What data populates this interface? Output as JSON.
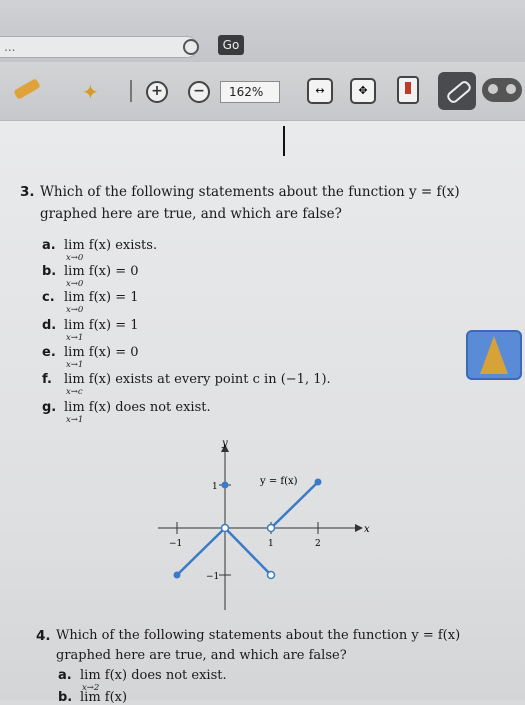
{
  "browser": {
    "url_text": "...",
    "go_label": "Go"
  },
  "toolbar": {
    "zoom": "162%",
    "pan_label": "↔",
    "fit_label": "✥"
  },
  "problem3": {
    "number": "3.",
    "stem_line1": "Which of the following statements about the function y = f(x)",
    "stem_line2": "graphed here are true, and which are false?",
    "items": [
      {
        "label": "a.",
        "text": "lim f(x) exists.",
        "sub": "x→0"
      },
      {
        "label": "b.",
        "text": "lim f(x) = 0",
        "sub": "x→0"
      },
      {
        "label": "c.",
        "text": "lim f(x) = 1",
        "sub": "x→0"
      },
      {
        "label": "d.",
        "text": "lim f(x) = 1",
        "sub": "x→1"
      },
      {
        "label": "e.",
        "text": "lim f(x) = 0",
        "sub": "x→1"
      },
      {
        "label": "f.",
        "text": "lim f(x) exists at every point c in (−1, 1).",
        "sub": "x→c"
      },
      {
        "label": "g.",
        "text": "lim f(x) does not exist.",
        "sub": "x→1"
      }
    ]
  },
  "graph": {
    "y_axis_label": "y",
    "x_axis_label": "x",
    "func_label": "y = f(x)",
    "tick_1y": "1",
    "tick_neg1y": "−1",
    "tick_neg1x": "−1",
    "tick_1x": "1",
    "tick_2x": "2"
  },
  "problem4": {
    "number": "4.",
    "stem_line1": "Which of the following statements about the function y = f(x)",
    "stem_line2": "graphed here are true, and which are false?",
    "item_a_label": "a.",
    "item_a_text": "lim f(x) does not exist.",
    "item_a_sub": "x→2",
    "item_b_label": "b.",
    "item_b_text": "lim f(x)"
  },
  "colors": {
    "curve": "#3a7bc8",
    "accent_widget": "#5a8bd6"
  }
}
